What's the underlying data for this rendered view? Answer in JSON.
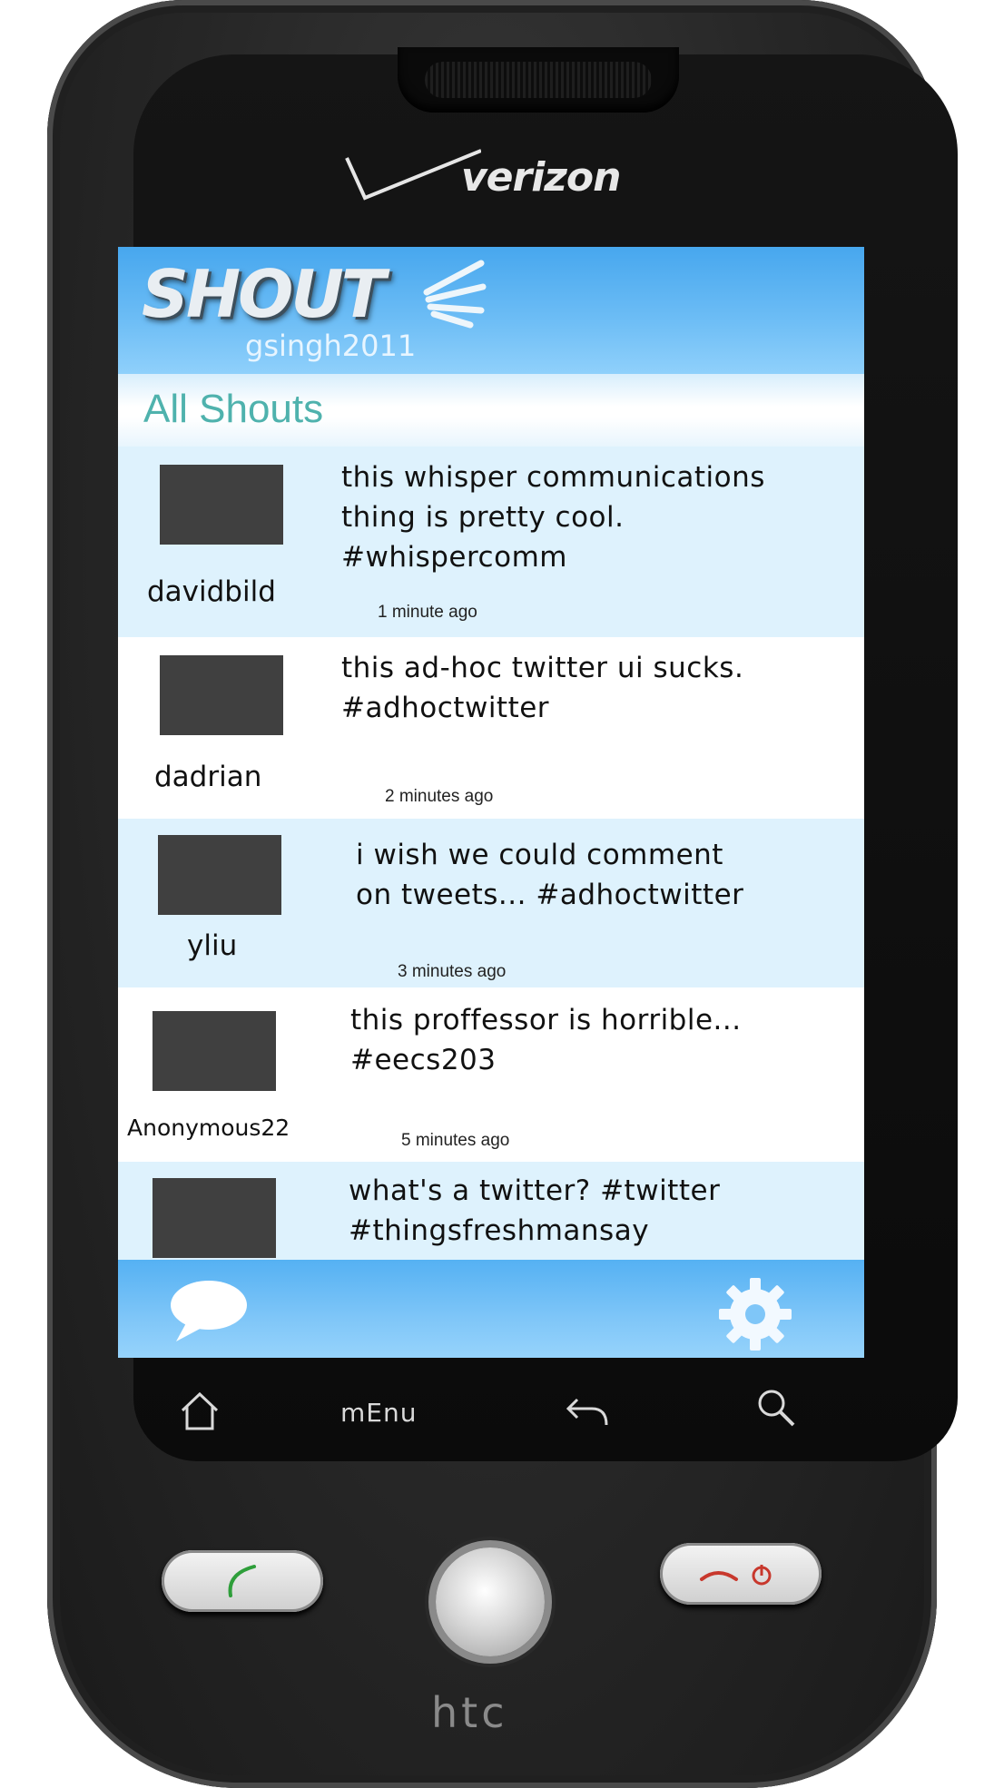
{
  "device": {
    "carrier": "verizon",
    "brand": "htc",
    "menu_key_label": "mEnu"
  },
  "app": {
    "logo": "SHOUT",
    "username": "gsingh2011",
    "section_title": "All Shouts",
    "colors": {
      "header_blue": "#47a7ee",
      "row_blue": "#def2fd",
      "title_teal": "#4fb2ad",
      "avatar_gray": "#404040"
    }
  },
  "feed": [
    {
      "user": "davidbild",
      "lines": [
        "this whisper communications",
        "thing is pretty cool.",
        "#whispercomm"
      ],
      "time": "1 minute ago"
    },
    {
      "user": "dadrian",
      "lines": [
        "this ad-hoc twitter ui sucks.",
        "#adhoctwitter"
      ],
      "time": "2 minutes ago"
    },
    {
      "user": "yliu",
      "lines": [
        "i wish we could comment",
        "on tweets... #adhoctwitter"
      ],
      "time": "3 minutes ago"
    },
    {
      "user": "Anonymous22",
      "lines": [
        "this proffessor is horrible...",
        "#eecs203"
      ],
      "time": "5 minutes ago"
    },
    {
      "user": "",
      "lines": [
        "what's a twitter? #twitter",
        "#thingsfreshmansay"
      ],
      "time": ""
    }
  ],
  "footer": {
    "left_icon": "speech-bubble-icon",
    "right_icon": "gear-icon"
  }
}
